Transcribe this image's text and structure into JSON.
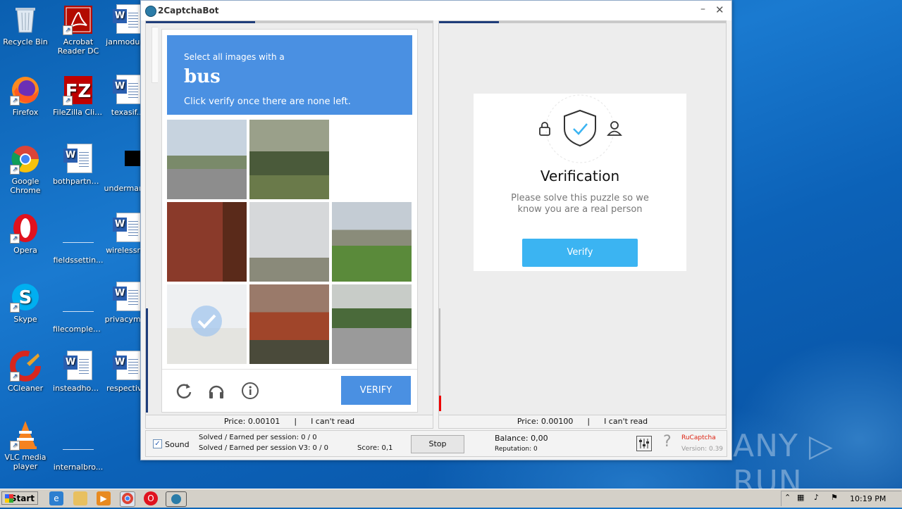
{
  "desktop": {
    "col1": [
      {
        "label": "Recycle Bin",
        "icon": "recycle-bin-icon"
      },
      {
        "label": "Firefox",
        "icon": "firefox-icon"
      },
      {
        "label": "Google Chrome",
        "icon": "chrome-icon"
      },
      {
        "label": "Opera",
        "icon": "opera-icon"
      },
      {
        "label": "Skype",
        "icon": "skype-icon"
      },
      {
        "label": "CCleaner",
        "icon": "ccleaner-icon"
      },
      {
        "label": "VLC media player",
        "icon": "vlc-icon"
      }
    ],
    "col2": [
      {
        "label": "Acrobat Reader DC",
        "icon": "acrobat-icon"
      },
      {
        "label": "FileZilla Client",
        "icon": "filezilla-icon"
      },
      {
        "label": "bothpartner...",
        "icon": "word-doc-icon"
      },
      {
        "label": "fieldssettin...",
        "icon": "file-icon"
      },
      {
        "label": "filecomplex....",
        "icon": "file-icon"
      },
      {
        "label": "insteadhom...",
        "icon": "word-doc-icon"
      },
      {
        "label": "internalbro...",
        "icon": "file-icon"
      }
    ],
    "col3": [
      {
        "label": "janmodul...",
        "icon": "word-doc-icon"
      },
      {
        "label": "texasif...",
        "icon": "word-doc-icon"
      },
      {
        "label": "underman...",
        "icon": "black-file-icon"
      },
      {
        "label": "wirelessn...",
        "icon": "word-doc-icon"
      },
      {
        "label": "privacymi...",
        "icon": "word-doc-icon"
      },
      {
        "label": "respectiv...",
        "icon": "word-doc-icon"
      }
    ]
  },
  "window": {
    "title": "2CaptchaBot",
    "minimize": "–",
    "close": "✕"
  },
  "left_pane": {
    "progress_percent": 38,
    "captcha": {
      "line1": "Select all images with a",
      "keyword": "bus",
      "line3": "Click verify once there are none left.",
      "verify_label": "VERIFY",
      "header_color": "#4a90e2"
    },
    "price_label": "Price: 0.00101",
    "separator": "|",
    "cant_read": "I can't read"
  },
  "right_pane": {
    "progress_percent": 21,
    "verification": {
      "title": "Verification",
      "text": "Please solve this puzzle so we know you are a real person",
      "button": "Verify",
      "button_color": "#3bb4f2"
    },
    "price_label": "Price: 0.00100",
    "separator": "|",
    "cant_read": "I can't read"
  },
  "status": {
    "sound_label": "Sound",
    "sound_checked": true,
    "solved_line1": "Solved / Earned per session: 0 / 0",
    "solved_line2": "Solved / Earned per session V3: 0 / 0",
    "score": "Score: 0,1",
    "stop_label": "Stop",
    "balance": "Balance:  0,00",
    "reputation": "Reputation: 0",
    "service": "RuCaptcha",
    "version": "Version: 0.39",
    "help": "?"
  },
  "taskbar": {
    "start_label": "Start",
    "clock": "10:19 PM"
  },
  "watermark": "ANY ▷ RUN"
}
